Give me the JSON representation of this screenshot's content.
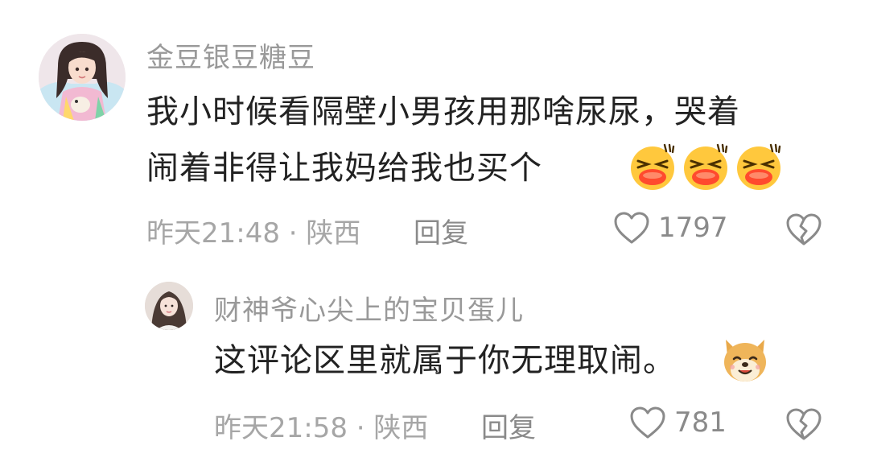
{
  "comments": [
    {
      "username": "金豆银豆糖豆",
      "text_line1": "我小时候看隔壁小男孩用那啥尿尿，哭着",
      "text_line2": "闹着非得让我妈给我也买个",
      "emojis": [
        "laughing-tears-emoji",
        "laughing-tears-emoji",
        "laughing-tears-emoji"
      ],
      "time": "昨天21:48",
      "separator": "·",
      "location": "陕西",
      "reply_label": "回复",
      "likes": "1797"
    },
    {
      "username": "财神爷心尖上的宝贝蛋儿",
      "text": "这评论区里就属于你无理取闹。",
      "emojis": [
        "doge-emoji"
      ],
      "time": "昨天21:58",
      "separator": "·",
      "location": "陕西",
      "reply_label": "回复",
      "likes": "781"
    }
  ],
  "colors": {
    "username": "#999999",
    "body_text": "#222222",
    "meta_text": "#a6a6a6",
    "action_text": "#8a8a8a"
  }
}
